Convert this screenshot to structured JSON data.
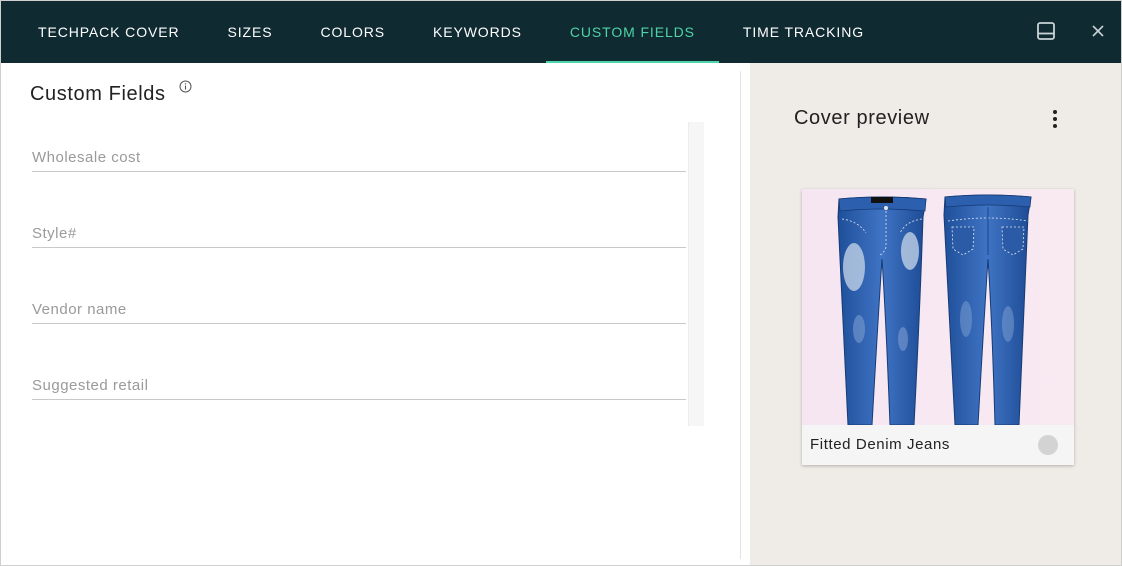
{
  "tabs": [
    {
      "label": "TECHPACK COVER"
    },
    {
      "label": "SIZES"
    },
    {
      "label": "COLORS"
    },
    {
      "label": "KEYWORDS"
    },
    {
      "label": "CUSTOM FIELDS",
      "active": true
    },
    {
      "label": "TIME TRACKING"
    }
  ],
  "header_icons": {
    "layout": "layout-panel-icon",
    "close": "close-icon"
  },
  "colors": {
    "topbar": "#0f2a31",
    "accent": "#4fd3a8",
    "preview_bg": "#efebe6"
  },
  "custom_fields": {
    "title": "Custom Fields",
    "info_icon": "info-icon",
    "fields": [
      {
        "placeholder": "Wholesale cost",
        "value": ""
      },
      {
        "placeholder": "Style#",
        "value": ""
      },
      {
        "placeholder": "Vendor name",
        "value": ""
      },
      {
        "placeholder": "Suggested retail",
        "value": ""
      }
    ]
  },
  "cover_preview": {
    "title": "Cover preview",
    "menu_icon": "more-vert-icon",
    "card": {
      "name": "Fitted Denim Jeans",
      "image": "denim-jeans-front-back"
    }
  }
}
